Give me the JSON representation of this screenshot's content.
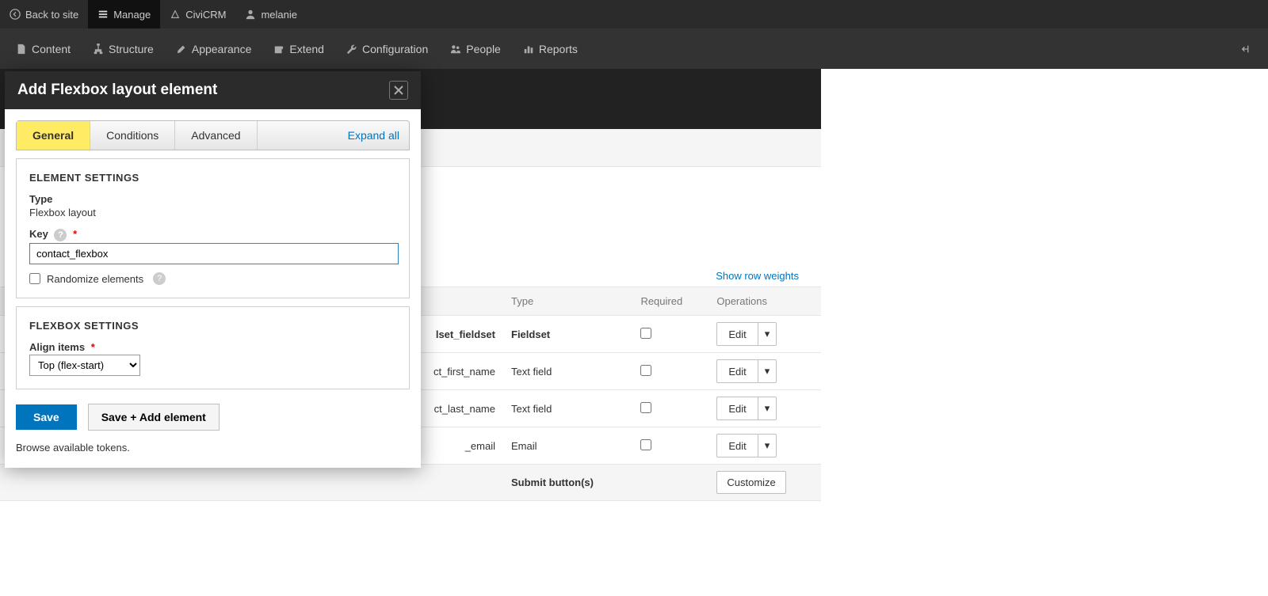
{
  "toolbar": {
    "back": "Back to site",
    "manage": "Manage",
    "civicrm": "CiviCRM",
    "user": "melanie",
    "content": "Content",
    "structure": "Structure",
    "appearance": "Appearance",
    "extend": "Extend",
    "configuration": "Configuration",
    "people": "People",
    "reports": "Reports"
  },
  "dialog": {
    "title": "Add Flexbox layout element",
    "tabs": {
      "general": "General",
      "conditions": "Conditions",
      "advanced": "Advanced"
    },
    "expand_all": "Expand all",
    "element_settings_heading": "ELEMENT SETTINGS",
    "type_label": "Type",
    "type_value": "Flexbox layout",
    "key_label": "Key",
    "key_value": "contact_flexbox",
    "randomize_label": "Randomize elements",
    "flexbox_settings_heading": "FLEXBOX SETTINGS",
    "align_items_label": "Align items",
    "align_items_value": "Top (flex-start)",
    "save": "Save",
    "save_add": "Save + Add element",
    "browse_tokens": "Browse available tokens."
  },
  "table": {
    "show_row_weights": "Show row weights",
    "headers": {
      "type": "Type",
      "required": "Required",
      "operations": "Operations"
    },
    "rows": [
      {
        "key_suffix": "lset_fieldset",
        "type": "Fieldset",
        "bold": true
      },
      {
        "key_suffix": "ct_first_name",
        "type": "Text field",
        "bold": false
      },
      {
        "key_suffix": "ct_last_name",
        "type": "Text field",
        "bold": false
      },
      {
        "key_suffix": "_email",
        "type": "Email",
        "bold": false
      }
    ],
    "submit_label": "Submit button(s)",
    "edit": "Edit",
    "customize": "Customize"
  }
}
